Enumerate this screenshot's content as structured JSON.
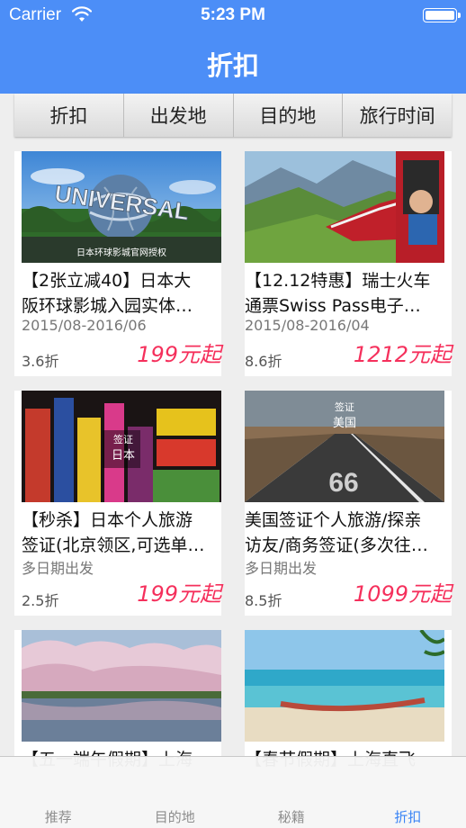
{
  "status": {
    "carrier": "Carrier",
    "time": "5:23 PM"
  },
  "nav": {
    "title": "折扣"
  },
  "filters": [
    "折扣",
    "出发地",
    "目的地",
    "旅行时间"
  ],
  "products": [
    {
      "title_line1": "【2张立减40】日本大",
      "title_line2": "阪环球影城入园实体…",
      "date": "2015/08-2016/06",
      "discount": "3.6折",
      "price": "199元起",
      "image_caption": "日本环球影城官网授权",
      "image_sign": "UNIVERSAL"
    },
    {
      "title_line1": "【12.12特惠】瑞士火车",
      "title_line2": "通票Swiss Pass电子…",
      "date": "2015/08-2016/04",
      "discount": "8.6折",
      "price": "1212元起"
    },
    {
      "title_line1": "【秒杀】日本个人旅游",
      "title_line2": "签证(北京领区,可选单…",
      "date": "多日期出发",
      "discount": "2.5折",
      "price": "199元起",
      "image_tag": "签证",
      "image_country": "日本"
    },
    {
      "title_line1": "美国签证个人旅游/探亲",
      "title_line2": "访友/商务签证(多次往…",
      "date": "多日期出发",
      "discount": "8.5折",
      "price": "1099元起",
      "image_tag": "签证",
      "image_country": "美国"
    },
    {
      "title_line1": "【五一端午假期】上海",
      "title_line2": ""
    },
    {
      "title_line1": "【春节假期】上海直飞",
      "title_line2": ""
    }
  ],
  "tabs": [
    {
      "label": "推荐"
    },
    {
      "label": "目的地"
    },
    {
      "label": "秘籍"
    },
    {
      "label": "折扣",
      "active": true
    }
  ],
  "colors": {
    "accent": "#4c8ef7",
    "price": "#f5305c",
    "tab_active": "#3a84f5"
  }
}
